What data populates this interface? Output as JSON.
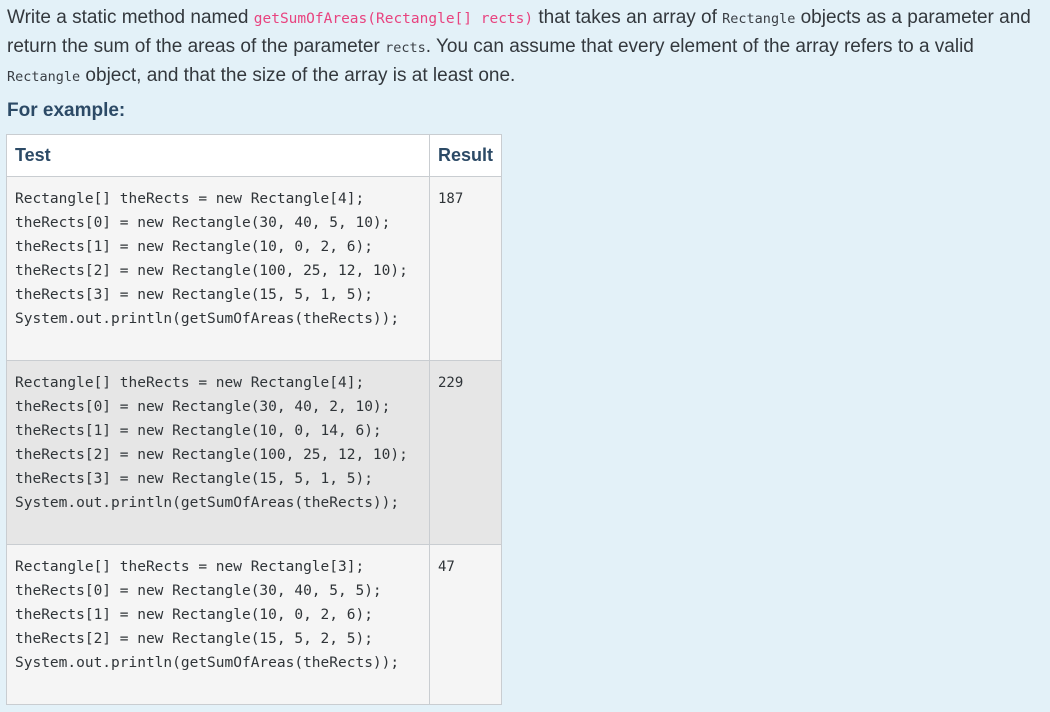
{
  "question": {
    "text_1": "Write a static method named ",
    "method_signature": "getSumOfAreas(Rectangle[] rects)",
    "text_2": " that takes an array of ",
    "class_name_1": "Rectangle",
    "text_3": " objects as a parameter and return the sum of the areas of the parameter ",
    "param_name": "rects",
    "text_4": ". You can assume that every element of the array refers to a valid ",
    "class_name_2": "Rectangle",
    "text_5": " object, and that the size of the array is at least one."
  },
  "for_example_label": "For example:",
  "table": {
    "headers": {
      "test": "Test",
      "result": "Result"
    },
    "rows": [
      {
        "lines": [
          "Rectangle[] theRects = new Rectangle[4];",
          "theRects[0] = new Rectangle(30, 40, 5, 10);",
          "theRects[1] = new Rectangle(10, 0, 2, 6);",
          "theRects[2] = new Rectangle(100, 25, 12, 10);",
          "theRects[3] = new Rectangle(15, 5, 1, 5);",
          "System.out.println(getSumOfAreas(theRects));"
        ],
        "result": "187"
      },
      {
        "lines": [
          "Rectangle[] theRects = new Rectangle[4];",
          "theRects[0] = new Rectangle(30, 40, 2, 10);",
          "theRects[1] = new Rectangle(10, 0, 14, 6);",
          "theRects[2] = new Rectangle(100, 25, 12, 10);",
          "theRects[3] = new Rectangle(15, 5, 1, 5);",
          "System.out.println(getSumOfAreas(theRects));"
        ],
        "result": "229"
      },
      {
        "lines": [
          "Rectangle[] theRects = new Rectangle[3];",
          "theRects[0] = new Rectangle(30, 40, 5, 5);",
          "theRects[1] = new Rectangle(10, 0, 2, 6);",
          "theRects[2] = new Rectangle(15, 5, 2, 5);",
          "System.out.println(getSumOfAreas(theRects));"
        ],
        "result": "47"
      }
    ]
  }
}
